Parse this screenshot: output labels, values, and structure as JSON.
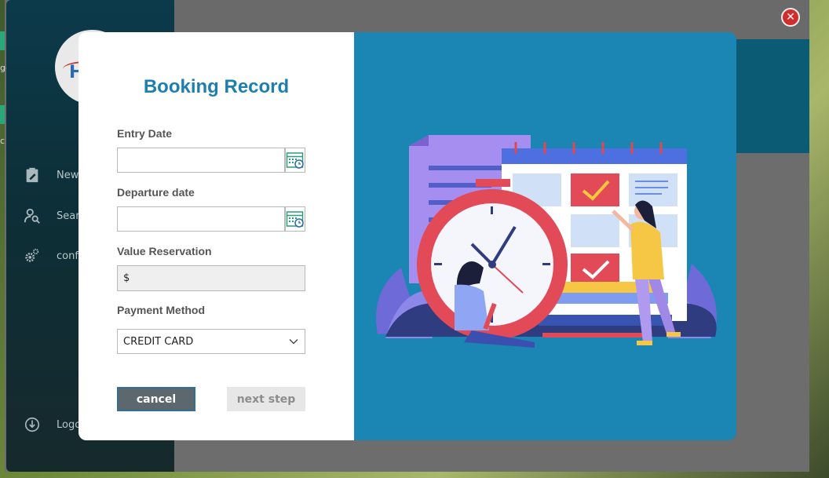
{
  "background_app": {
    "logo_text": "H",
    "sidebar_items": [
      {
        "label": "New",
        "icon": "clipboard-edit-icon"
      },
      {
        "label": "Searc",
        "icon": "user-search-icon"
      },
      {
        "label": "confi",
        "icon": "gears-icon"
      }
    ],
    "logout_label": "Logo",
    "edge_labels": [
      "ge",
      "c"
    ]
  },
  "modal": {
    "title": "Booking Record",
    "fields": {
      "entry_date_label": "Entry Date",
      "entry_date_value": "",
      "departure_date_label": "Departure date",
      "departure_date_value": "",
      "value_label": "Value Reservation",
      "value_value": "$",
      "payment_label": "Payment Method",
      "payment_value": "CREDIT CARD"
    },
    "buttons": {
      "cancel": "cancel",
      "next": "next step"
    }
  },
  "colors": {
    "title": "#1d7fb0",
    "illustration_bg": "#1b85b3",
    "sidebar": "#0c3a4b",
    "close": "#d22d2d"
  }
}
